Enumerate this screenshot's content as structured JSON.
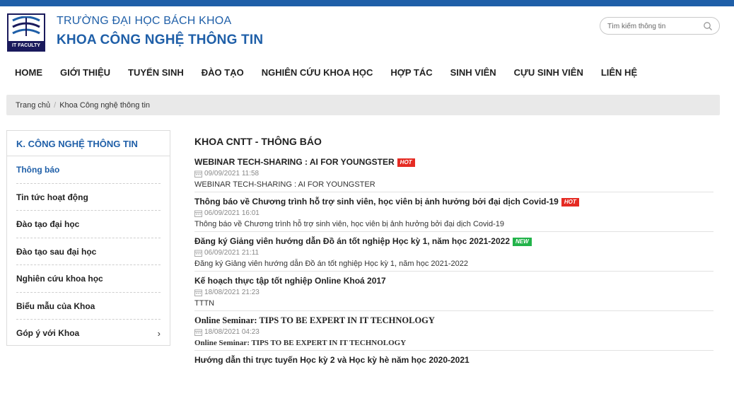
{
  "header": {
    "logo_text": "IT FACULTY",
    "line1": "TRƯỜNG ĐẠI HỌC BÁCH KHOA",
    "line2": "KHOA CÔNG NGHỆ THÔNG TIN",
    "search_placeholder": "Tìm kiếm thông tin",
    "search_icon": "search-icon",
    "brand_color": "#1f5fa8"
  },
  "nav": {
    "items": [
      "HOME",
      "GIỚI THIỆU",
      "TUYỂN SINH",
      "ĐÀO TẠO",
      "NGHIÊN CỨU KHOA HỌC",
      "HỢP TÁC",
      "SINH VIÊN",
      "CỰU SINH VIÊN",
      "LIÊN HỆ"
    ]
  },
  "breadcrumb": {
    "home": "Trang chủ",
    "separator": "/",
    "current": "Khoa Công nghệ thông tin"
  },
  "sidebar": {
    "title": "K. CÔNG NGHỆ THÔNG TIN",
    "items": [
      {
        "label": "Thông báo",
        "active": true
      },
      {
        "label": "Tin tức hoạt động"
      },
      {
        "label": "Đào tạo đại học"
      },
      {
        "label": "Đào tạo sau đại học"
      },
      {
        "label": "Nghiên cứu khoa học"
      },
      {
        "label": "Biểu mẫu của Khoa"
      },
      {
        "label": "Góp ý với Khoa",
        "chevron": "›"
      }
    ]
  },
  "main": {
    "title": "KHOA CNTT - THÔNG BÁO",
    "posts": [
      {
        "title": "WEBINAR TECH-SHARING : AI FOR YOUNGSTER",
        "badge": "HOT",
        "date": "09/09/2021 11:58",
        "summary": "WEBINAR TECH-SHARING : AI FOR YOUNGSTER"
      },
      {
        "title": "Thông báo về Chương trình hỗ trợ sinh viên, học viên bị ảnh hưởng bởi đại dịch Covid-19",
        "badge": "HOT",
        "date": "06/09/2021 16:01",
        "summary": "Thông báo về Chương trình hỗ trợ sinh viên, học viên bị ảnh hưởng bởi đại dịch Covid-19"
      },
      {
        "title": "Đăng ký Giảng viên hướng dẫn Đồ án tốt nghiệp Học kỳ 1, năm học 2021-2022",
        "badge": "NEW",
        "date": "06/09/2021 21:11",
        "summary": "Đăng ký Giảng viên hướng dẫn Đồ án tốt nghiệp Học kỳ 1, năm học 2021-2022"
      },
      {
        "title": "Kế hoạch thực tập tốt nghiệp Online Khoá 2017",
        "date": "18/08/2021 21:23",
        "summary": "TTTN"
      },
      {
        "title": "Online Seminar: TIPS TO BE EXPERT IN IT TECHNOLOGY",
        "date": "18/08/2021 04:23",
        "summary": "Online Seminar: TIPS TO BE EXPERT IN IT TECHNOLOGY"
      },
      {
        "title": "Hướng dẫn thi trực tuyến Học kỳ 2 và Học kỳ hè năm học 2020-2021"
      }
    ]
  }
}
